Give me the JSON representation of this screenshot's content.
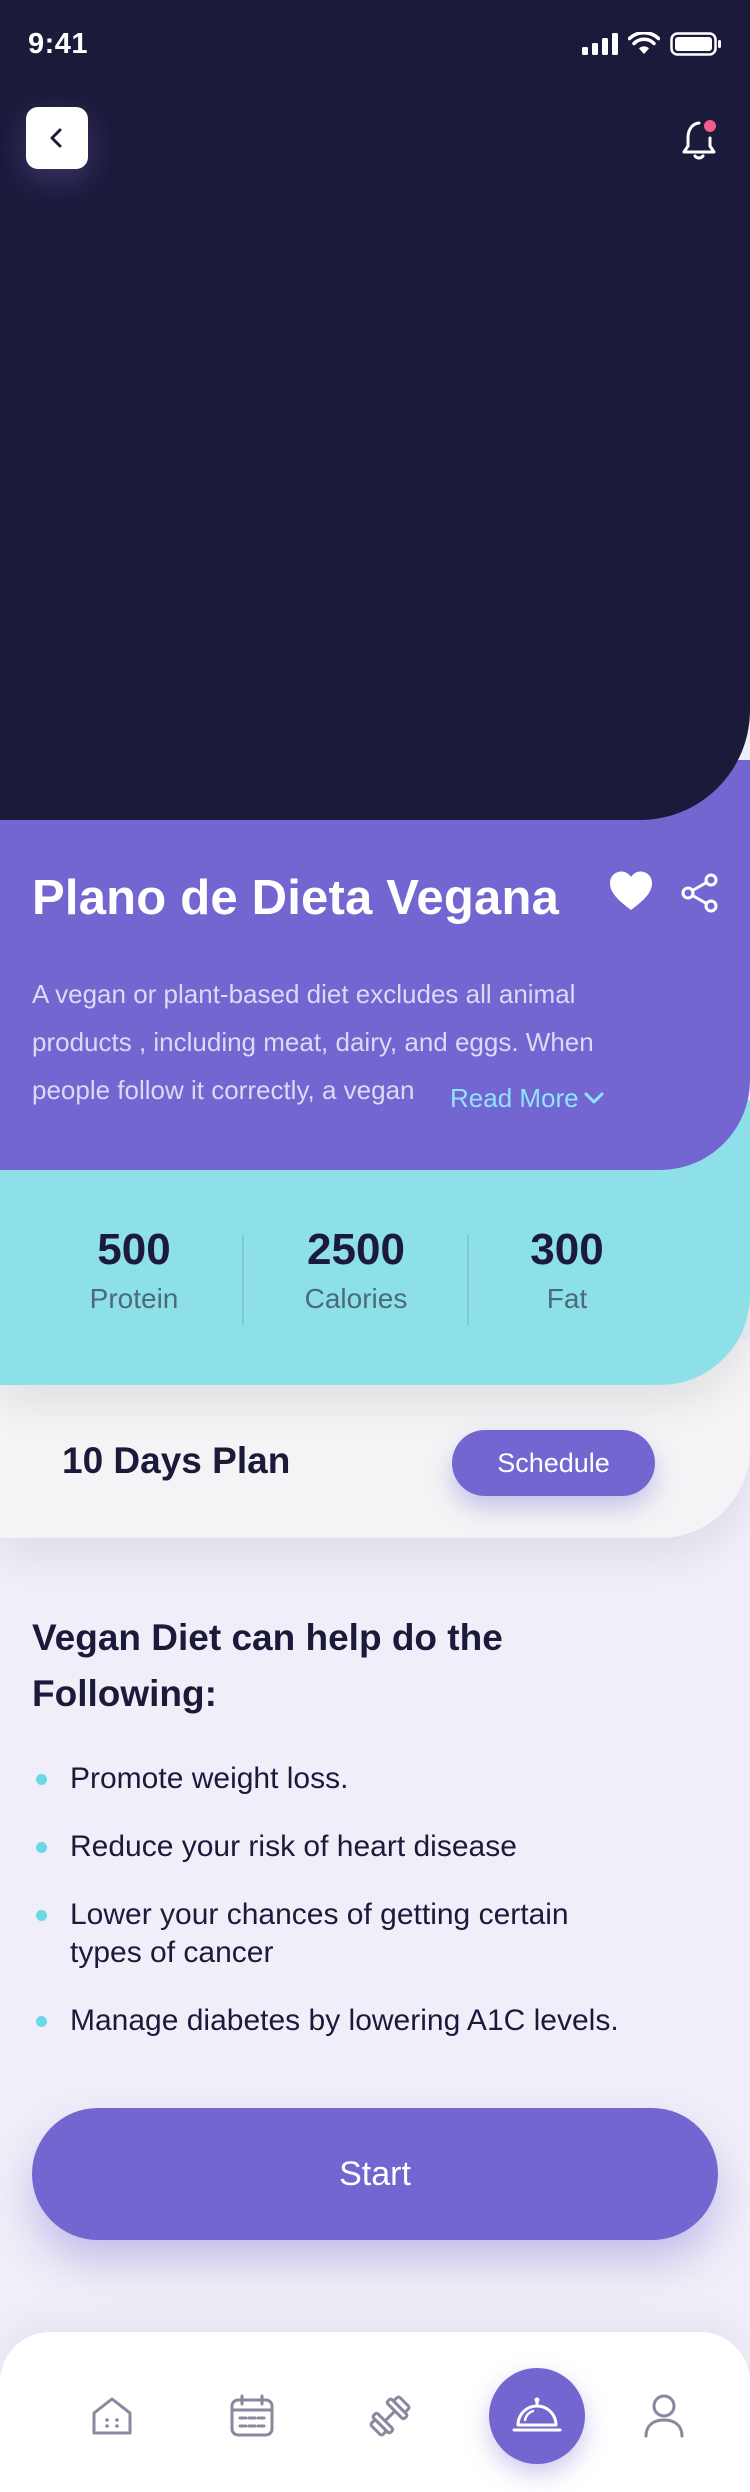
{
  "status_bar": {
    "time": "9:41"
  },
  "plan": {
    "title": "Plano de Dieta Vegana",
    "description": "A vegan or plant-based diet excludes all animal products , including meat, dairy, and eggs. When people follow it correctly, a vegan",
    "read_more": "Read More"
  },
  "stats": [
    {
      "value": "500",
      "label": "Protein"
    },
    {
      "value": "2500",
      "label": "Calories"
    },
    {
      "value": "300",
      "label": "Fat"
    }
  ],
  "plan_card": {
    "label": "10 Days Plan",
    "schedule_label": "Schedule"
  },
  "benefits": {
    "title": "Vegan Diet can help do the Following:",
    "items": [
      "Promote weight loss.",
      "Reduce your risk of heart disease",
      "Lower your chances of getting certain types of cancer",
      "Manage diabetes by lowering A1C levels."
    ]
  },
  "start_label": "Start",
  "nav": {
    "items": [
      "home-icon",
      "calendar-icon",
      "dumbbell-icon",
      "cloche-icon",
      "profile-icon"
    ],
    "active": "cloche-icon"
  },
  "colors": {
    "hero_bg": "#1c1a3b",
    "accent": "#7366d1",
    "stats_bg": "#8ee0e8",
    "link": "#8ee3ff",
    "notification_dot": "#f25c8a"
  }
}
